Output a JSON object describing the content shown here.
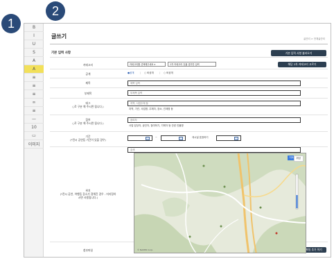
{
  "badges": {
    "one": "1",
    "two": "2"
  },
  "sidebar": {
    "items": [
      "B",
      "I",
      "U",
      "S",
      "A",
      "A",
      "≡",
      "≡",
      "≡",
      "∞",
      "≡",
      "—",
      "10",
      "▭",
      "이미지"
    ],
    "active_index": 5
  },
  "header": {
    "title": "글쓰기",
    "breadcrumb": "글관리 > 전체글관리"
  },
  "section": {
    "title": "기본 입력 사항",
    "load_button": "기본 입력 사항 불러오기"
  },
  "fields": {
    "category": {
      "label": "카테고리",
      "select1": "카테고리를 선택해주세요 ▾",
      "select2": "2차 카테고리 있을 경우만 입력",
      "button": "해당 2차 카테고리 고르기"
    },
    "visibility": {
      "label": "공개",
      "options": [
        "●공개",
        "○ 비공개",
        "○ 비공개"
      ],
      "separators": [
        "|",
        "|"
      ]
    },
    "title": {
      "label": "제목",
      "placeholder": "제목 입력"
    },
    "subtitle": {
      "label": "부제목",
      "placeholder": "부제목 입력"
    },
    "tags": {
      "label": "태그",
      "label_note": "(,로 구분 해 주시면 됩니다.)",
      "placeholder": "지역, 사업주체 등",
      "hint": "지역, 기관, 사업명, 주체자, 장소, 관계명 등"
    },
    "keywords": {
      "label": "참여",
      "label_note": "(,로 구분 해 주시면 됩니다.)",
      "placeholder": "참여자",
      "hint": "사업 담당자, 공인자, 참여하기, 기획자 등 관련 인물명"
    },
    "period": {
      "label": "기간",
      "label_note": "(*전시 공연등 기간이 있을 경우)",
      "separator": "~",
      "third_label": "게시일 표현하기"
    },
    "place": {
      "label": "위치",
      "label_note": "(*전시 공연, 여행등 장소가 정해진 경우 - 미지정하시면 사용됩니다.)",
      "placeholder": "검색",
      "map_type_map": "지도",
      "map_type_sky": "위성",
      "map_footer": "© NAVER Corp."
    },
    "attachment": {
      "label": "첨부파일",
      "button": "파일 추가 하기"
    }
  },
  "colors": {
    "badge": "#2a4a78",
    "button_dark": "#2c3e50",
    "active_tool": "#f2e05a",
    "map_green": "#cfdcbf",
    "map_road": "#f0c36b"
  }
}
